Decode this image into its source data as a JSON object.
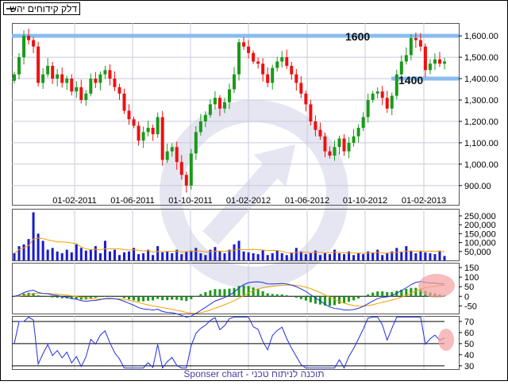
{
  "legend": {
    "label": "דלק קידוחים יהש"
  },
  "footer": {
    "text": "Sponser chart - תוכנה לניתוח טכני"
  },
  "colors": {
    "up": "#1a9a1a",
    "down": "#ee1111",
    "volume": "#1a1acc",
    "ma": "#f0a000",
    "macd": "#2030e0",
    "signal": "#f0a000",
    "hist": "#1a9a1a",
    "support": "#80b8f0",
    "highlight": "#f4a0a0"
  },
  "chart_data": {
    "type": "candlestick",
    "title": "דלק קידוחים יהש",
    "x_ticks": [
      "01-02-2011",
      "01-06-2011",
      "01-10-2011",
      "01-02-2012",
      "01-06-2012",
      "01-10-2012",
      "01-02-2013"
    ],
    "price_axis": {
      "ticks": [
        "900.00",
        "1,000.00",
        "1,100.00",
        "1,200.00",
        "1,300.00",
        "1,400.00",
        "1,500.00",
        "1,600.00"
      ],
      "tick_values": [
        900,
        1000,
        1100,
        1200,
        1300,
        1400,
        1500,
        1600
      ],
      "range": [
        810,
        1660
      ]
    },
    "support_lines": [
      {
        "value": 1600,
        "label": "1600"
      },
      {
        "value": 1400,
        "label": "1400"
      }
    ],
    "closes": [
      1420,
      1500,
      1600,
      1580,
      1550,
      1380,
      1420,
      1460,
      1400,
      1420,
      1380,
      1400,
      1340,
      1360,
      1300,
      1330,
      1400,
      1380,
      1420,
      1440,
      1400,
      1360,
      1330,
      1250,
      1210,
      1180,
      1110,
      1150,
      1170,
      1140,
      1220,
      1020,
      1060,
      1080,
      1010,
      950,
      900,
      1050,
      1150,
      1200,
      1230,
      1280,
      1310,
      1260,
      1290,
      1350,
      1420,
      1570,
      1550,
      1520,
      1480,
      1470,
      1420,
      1380,
      1450,
      1480,
      1500,
      1460,
      1420,
      1380,
      1330,
      1280,
      1200,
      1160,
      1130,
      1060,
      1040,
      1080,
      1120,
      1060,
      1100,
      1130,
      1170,
      1220,
      1300,
      1330,
      1340,
      1310,
      1260,
      1320,
      1420,
      1480,
      1510,
      1590,
      1580,
      1550,
      1440,
      1470,
      1490,
      1470,
      1480
    ],
    "volume": [
      40000,
      80000,
      90000,
      120000,
      270000,
      150000,
      110000,
      60000,
      70000,
      50000,
      40000,
      60000,
      45000,
      90000,
      70000,
      55000,
      60000,
      80000,
      40000,
      110000,
      50000,
      60000,
      30000,
      45000,
      50000,
      70000,
      35000,
      40000,
      60000,
      30000,
      80000,
      45000,
      50000,
      40000,
      60000,
      35000,
      50000,
      55000,
      70000,
      40000,
      30000,
      60000,
      75000,
      50000,
      40000,
      60000,
      90000,
      110000,
      50000,
      45000,
      40000,
      35000,
      60000,
      30000,
      40000,
      55000,
      40000,
      30000,
      45000,
      70000,
      50000,
      35000,
      40000,
      55000,
      30000,
      40000,
      35000,
      60000,
      40000,
      35000,
      50000,
      30000,
      40000,
      35000,
      50000,
      45000,
      60000,
      30000,
      40000,
      50000,
      70000,
      50000,
      80000,
      55000,
      40000,
      50000,
      45000,
      40000,
      35000,
      55000,
      25000
    ],
    "volume_axis": {
      "ticks": [
        "50,000",
        "100,000",
        "150,000",
        "200,000",
        "250,000"
      ],
      "tick_values": [
        50000,
        100000,
        150000,
        200000,
        250000
      ],
      "range": [
        0,
        290000
      ]
    },
    "macd_axis": {
      "ticks": [
        "-50",
        "0",
        "50",
        "100",
        "150"
      ],
      "tick_values": [
        -50,
        0,
        50,
        100,
        150
      ],
      "range": [
        -90,
        175
      ]
    },
    "rsi_axis": {
      "ticks": [
        "30",
        "40",
        "50",
        "60",
        "70"
      ],
      "tick_values": [
        30,
        40,
        50,
        60,
        70
      ],
      "range": [
        27,
        75
      ],
      "reference_lines": [
        30,
        50,
        70
      ]
    }
  }
}
